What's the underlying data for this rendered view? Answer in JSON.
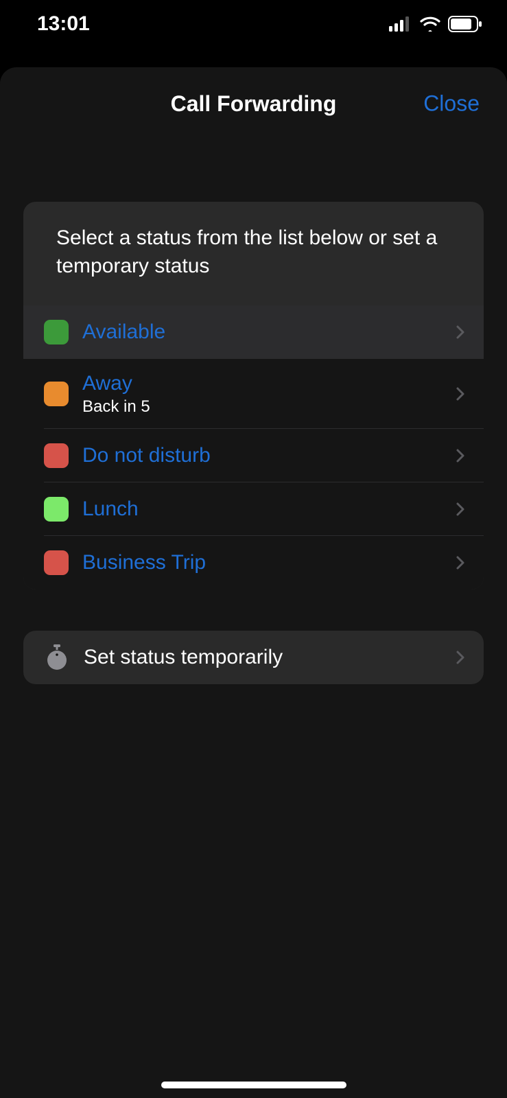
{
  "statusbar": {
    "time": "13:01"
  },
  "header": {
    "title": "Call Forwarding",
    "close": "Close"
  },
  "instructions": "Select a status from the list below or set a temporary status",
  "statuses": [
    {
      "label": "Available",
      "sublabel": "",
      "color": "#3c9a3a",
      "selected": true
    },
    {
      "label": "Away",
      "sublabel": "Back in 5",
      "color": "#e88b2e",
      "selected": false
    },
    {
      "label": "Do not disturb",
      "sublabel": "",
      "color": "#d6534a",
      "selected": false
    },
    {
      "label": "Lunch",
      "sublabel": "",
      "color": "#7ce96a",
      "selected": false
    },
    {
      "label": "Business Trip",
      "sublabel": "",
      "color": "#d6534a",
      "selected": false
    }
  ],
  "temporary": {
    "label": "Set status temporarily"
  }
}
